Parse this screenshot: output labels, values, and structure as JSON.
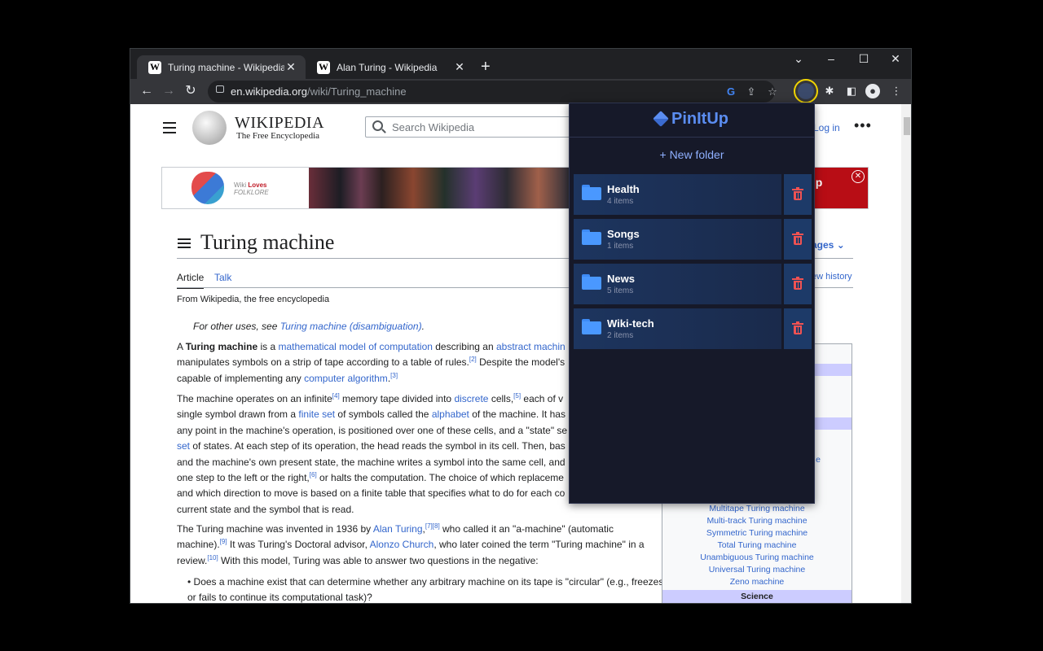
{
  "browser": {
    "tabs": [
      {
        "title": "Turing machine - Wikipedia",
        "favicon": "W",
        "active": true
      },
      {
        "title": "Alan Turing - Wikipedia",
        "favicon": "W",
        "active": false
      }
    ],
    "new_tab": "+",
    "window_controls": {
      "dropdown": "⌄",
      "minimize": "–",
      "maximize": "☐",
      "close": "✕"
    },
    "nav": {
      "back": "←",
      "forward": "→",
      "reload": "↻"
    },
    "url_domain": "en.wikipedia.org",
    "url_path": "/wiki/Turing_machine",
    "toolbar_icons": [
      "google-icon",
      "share-icon",
      "star-icon",
      "pinitup-extension-icon",
      "puzzle-icon",
      "side-panel-icon",
      "profile-icon",
      "menu-icon"
    ]
  },
  "wiki": {
    "logo_title": "WIKIPEDIA",
    "logo_subtitle": "The Free Encyclopedia",
    "search_placeholder": "Search Wikipedia",
    "login": "Log in",
    "more": "•••",
    "banner": {
      "brand_small": "Wiki",
      "brand_loves": "Loves",
      "brand_folklore": "FOLKLORE",
      "cta": "e, help",
      "close": "✕"
    },
    "page_title": "Turing machine",
    "languages": "ages",
    "tab_article": "Article",
    "tab_talk": "Talk",
    "view_history": "ew history",
    "from": "From Wikipedia, the free encyclopedia",
    "hatnote_prefix": "For other uses, see ",
    "hatnote_link": "Turing machine (disambiguation)",
    "hatnote_suffix": ".",
    "infobox_items": [
      "Multitape Turing machine",
      "Multi-track Turing machine",
      "Symmetric Turing machine",
      "Total Turing machine",
      "Unambiguous Turing machine",
      "Universal Turing machine",
      "Zeno machine"
    ],
    "infobox_partial": "e",
    "infobox_section": "Science",
    "bullet": "Does a machine exist that can determine whether any arbitrary machine on its tape is \"circular\" (e.g., freezes, or fails to continue its computational task)?"
  },
  "popup": {
    "brand": "PinItUp",
    "new_folder": "+ New folder",
    "folders": [
      {
        "name": "Health",
        "count": "4 items"
      },
      {
        "name": "Songs",
        "count": "1 items"
      },
      {
        "name": "News",
        "count": "5 items"
      },
      {
        "name": "Wiki-tech",
        "count": "2 items"
      }
    ]
  },
  "colors": {
    "popup_bg": "#161929",
    "folder_bg": "#1d355f",
    "accent": "#5b8df1",
    "delete": "#f05252",
    "highlight_ring": "#f2d500",
    "link": "#3366cc"
  }
}
